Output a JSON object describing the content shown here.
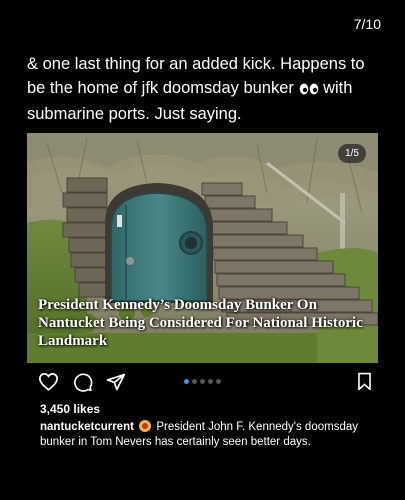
{
  "story": {
    "counter": "7/10",
    "caption_part1": "& one last thing for an added kick. Happens to be the home of jfk doomsday bunker ",
    "caption_eyes_icon": "eyes-emoji",
    "caption_part2": " with submarine ports. Just saying."
  },
  "post": {
    "image_counter": "1/5",
    "headline": "President Kennedy’s Doomsday Bunker On Nantucket Being Considered For National Historic Landmark",
    "carousel": {
      "total": 5,
      "active_index": 0
    },
    "likes": "3,450 likes",
    "username": "nantucketcurrent",
    "username_badge_icon": "radioactive-emoji",
    "description": " President John F. Kennedy's doomsday bunker in Tom Nevers has certainly seen better days."
  },
  "icons": {
    "like": "heart-icon",
    "comment": "comment-icon",
    "share": "send-icon",
    "save": "bookmark-icon"
  },
  "colors": {
    "background": "#000000",
    "carousel_active": "#3897f0",
    "bunker_door": "#3e7c7c"
  }
}
